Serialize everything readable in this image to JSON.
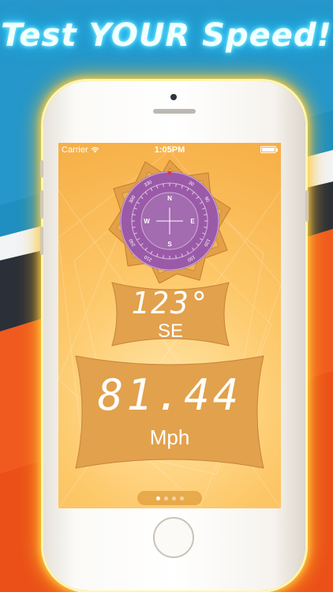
{
  "headline": "Test YOUR Speed!",
  "status_bar": {
    "carrier": "Carrier",
    "time": "1:05PM",
    "battery_level": 1.0
  },
  "compass": {
    "cardinals": [
      "N",
      "E",
      "S",
      "W"
    ],
    "degree_labels": [
      "30",
      "60",
      "120",
      "150",
      "210",
      "240",
      "300",
      "330"
    ],
    "dial_color": "#9b5aa8",
    "pointer_color": "#e0384a"
  },
  "heading": {
    "degrees": "123°",
    "direction": "SE"
  },
  "speed": {
    "value": "81.44",
    "unit": "Mph"
  },
  "pager": {
    "page_count": 4,
    "active_index": 0
  },
  "colors": {
    "background_blue": "#1e8fc0",
    "background_orange": "#f05a1e",
    "screen_orange": "#f6ae45",
    "neon_yellow": "#ffd24a",
    "neon_cyan": "#5fe0ff"
  }
}
